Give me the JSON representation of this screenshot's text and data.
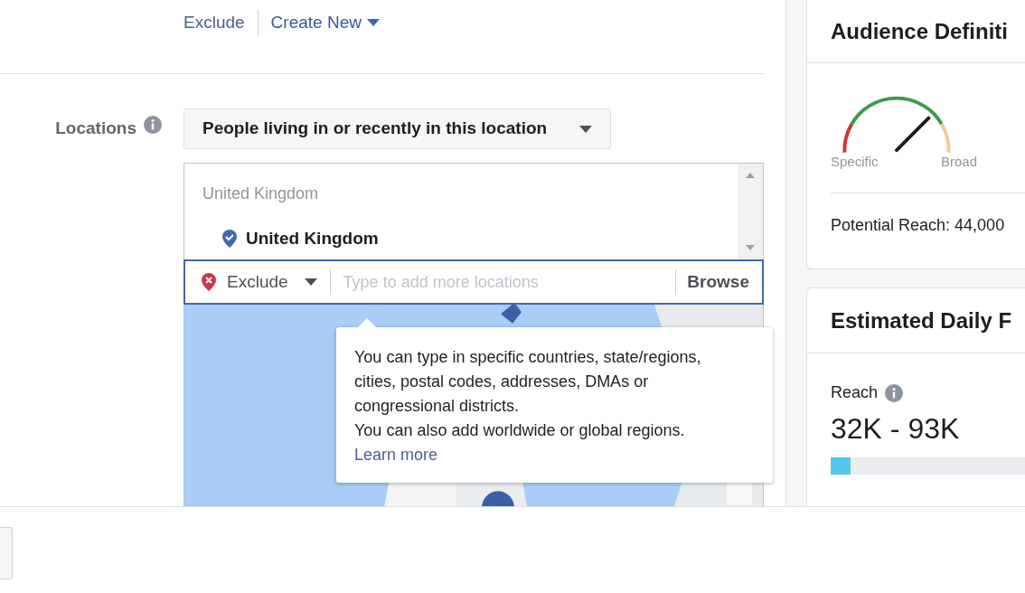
{
  "audience_links": [
    {
      "label": "Exclude",
      "kind": "plain"
    },
    {
      "label": "Create New",
      "kind": "dropdown"
    }
  ],
  "locations": {
    "label": "Locations",
    "type_dropdown": "People living in or recently in this location",
    "list_header": "United Kingdom",
    "included": [
      {
        "name": "United Kingdom"
      }
    ],
    "mode": "Exclude",
    "placeholder": "Type to add more locations",
    "browse": "Browse",
    "tooltip": {
      "text": "You can type in specific countries, state/regions, cities, postal codes, addresses, DMAs or congressional districts.",
      "text2": "You can also add worldwide or global regions.",
      "link": "Learn more"
    }
  },
  "audience_definition": {
    "title": "Audience Definiti",
    "left_label": "Specific",
    "right_label": "Broad",
    "potential_reach": "Potential Reach: 44,000"
  },
  "estimated_daily": {
    "title": "Estimated Daily F",
    "reach_label": "Reach",
    "reach_value": "32K - 93K",
    "level": 0.1
  }
}
